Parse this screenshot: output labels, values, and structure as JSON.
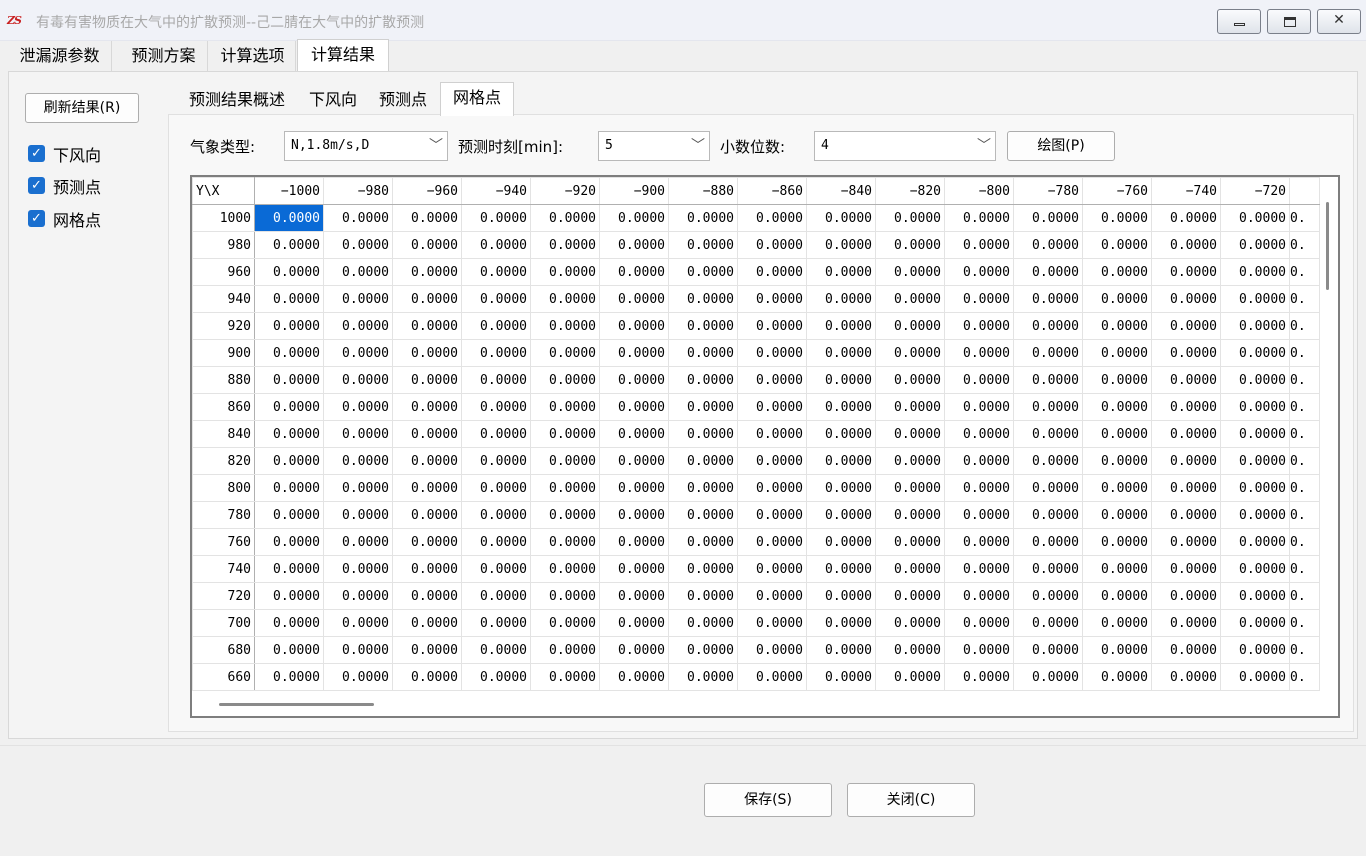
{
  "window": {
    "icon_text": "ZS",
    "title": "有毒有害物质在大气中的扩散预测--己二腈在大气中的扩散预测",
    "controls": {
      "minimize": "—",
      "maximize": "□",
      "close": "✕"
    }
  },
  "main_tabs": [
    "泄漏源参数",
    "预测方案",
    "计算选项",
    "计算结果"
  ],
  "sidebar": {
    "refresh_label": "刷新结果(R)",
    "checks": [
      {
        "label": "下风向",
        "checked": true
      },
      {
        "label": "预测点",
        "checked": true
      },
      {
        "label": "网格点",
        "checked": true
      }
    ]
  },
  "sub_tabs": [
    "预测结果概述",
    "下风向",
    "预测点",
    "网格点"
  ],
  "filters": {
    "weather_label": "气象类型:",
    "weather_value": "N,1.8m/s,D",
    "time_label": "预测时刻[min]:",
    "time_value": "5",
    "decimals_label": "小数位数:",
    "decimals_value": "4",
    "plot_label": "绘图(P)"
  },
  "grid": {
    "corner": "Y\\X",
    "columns": [
      "−1000",
      "−980",
      "−960",
      "−940",
      "−920",
      "−900",
      "−880",
      "−860",
      "−840",
      "−820",
      "−800",
      "−780",
      "−760",
      "−740",
      "−720",
      ""
    ],
    "rows": [
      {
        "y": "1000",
        "cells": [
          "0.0000",
          "0.0000",
          "0.0000",
          "0.0000",
          "0.0000",
          "0.0000",
          "0.0000",
          "0.0000",
          "0.0000",
          "0.0000",
          "0.0000",
          "0.0000",
          "0.0000",
          "0.0000",
          "0.0000",
          "0."
        ]
      },
      {
        "y": "980",
        "cells": [
          "0.0000",
          "0.0000",
          "0.0000",
          "0.0000",
          "0.0000",
          "0.0000",
          "0.0000",
          "0.0000",
          "0.0000",
          "0.0000",
          "0.0000",
          "0.0000",
          "0.0000",
          "0.0000",
          "0.0000",
          "0."
        ]
      },
      {
        "y": "960",
        "cells": [
          "0.0000",
          "0.0000",
          "0.0000",
          "0.0000",
          "0.0000",
          "0.0000",
          "0.0000",
          "0.0000",
          "0.0000",
          "0.0000",
          "0.0000",
          "0.0000",
          "0.0000",
          "0.0000",
          "0.0000",
          "0."
        ]
      },
      {
        "y": "940",
        "cells": [
          "0.0000",
          "0.0000",
          "0.0000",
          "0.0000",
          "0.0000",
          "0.0000",
          "0.0000",
          "0.0000",
          "0.0000",
          "0.0000",
          "0.0000",
          "0.0000",
          "0.0000",
          "0.0000",
          "0.0000",
          "0."
        ]
      },
      {
        "y": "920",
        "cells": [
          "0.0000",
          "0.0000",
          "0.0000",
          "0.0000",
          "0.0000",
          "0.0000",
          "0.0000",
          "0.0000",
          "0.0000",
          "0.0000",
          "0.0000",
          "0.0000",
          "0.0000",
          "0.0000",
          "0.0000",
          "0."
        ]
      },
      {
        "y": "900",
        "cells": [
          "0.0000",
          "0.0000",
          "0.0000",
          "0.0000",
          "0.0000",
          "0.0000",
          "0.0000",
          "0.0000",
          "0.0000",
          "0.0000",
          "0.0000",
          "0.0000",
          "0.0000",
          "0.0000",
          "0.0000",
          "0."
        ]
      },
      {
        "y": "880",
        "cells": [
          "0.0000",
          "0.0000",
          "0.0000",
          "0.0000",
          "0.0000",
          "0.0000",
          "0.0000",
          "0.0000",
          "0.0000",
          "0.0000",
          "0.0000",
          "0.0000",
          "0.0000",
          "0.0000",
          "0.0000",
          "0."
        ]
      },
      {
        "y": "860",
        "cells": [
          "0.0000",
          "0.0000",
          "0.0000",
          "0.0000",
          "0.0000",
          "0.0000",
          "0.0000",
          "0.0000",
          "0.0000",
          "0.0000",
          "0.0000",
          "0.0000",
          "0.0000",
          "0.0000",
          "0.0000",
          "0."
        ]
      },
      {
        "y": "840",
        "cells": [
          "0.0000",
          "0.0000",
          "0.0000",
          "0.0000",
          "0.0000",
          "0.0000",
          "0.0000",
          "0.0000",
          "0.0000",
          "0.0000",
          "0.0000",
          "0.0000",
          "0.0000",
          "0.0000",
          "0.0000",
          "0."
        ]
      },
      {
        "y": "820",
        "cells": [
          "0.0000",
          "0.0000",
          "0.0000",
          "0.0000",
          "0.0000",
          "0.0000",
          "0.0000",
          "0.0000",
          "0.0000",
          "0.0000",
          "0.0000",
          "0.0000",
          "0.0000",
          "0.0000",
          "0.0000",
          "0."
        ]
      },
      {
        "y": "800",
        "cells": [
          "0.0000",
          "0.0000",
          "0.0000",
          "0.0000",
          "0.0000",
          "0.0000",
          "0.0000",
          "0.0000",
          "0.0000",
          "0.0000",
          "0.0000",
          "0.0000",
          "0.0000",
          "0.0000",
          "0.0000",
          "0."
        ]
      },
      {
        "y": "780",
        "cells": [
          "0.0000",
          "0.0000",
          "0.0000",
          "0.0000",
          "0.0000",
          "0.0000",
          "0.0000",
          "0.0000",
          "0.0000",
          "0.0000",
          "0.0000",
          "0.0000",
          "0.0000",
          "0.0000",
          "0.0000",
          "0."
        ]
      },
      {
        "y": "760",
        "cells": [
          "0.0000",
          "0.0000",
          "0.0000",
          "0.0000",
          "0.0000",
          "0.0000",
          "0.0000",
          "0.0000",
          "0.0000",
          "0.0000",
          "0.0000",
          "0.0000",
          "0.0000",
          "0.0000",
          "0.0000",
          "0."
        ]
      },
      {
        "y": "740",
        "cells": [
          "0.0000",
          "0.0000",
          "0.0000",
          "0.0000",
          "0.0000",
          "0.0000",
          "0.0000",
          "0.0000",
          "0.0000",
          "0.0000",
          "0.0000",
          "0.0000",
          "0.0000",
          "0.0000",
          "0.0000",
          "0."
        ]
      },
      {
        "y": "720",
        "cells": [
          "0.0000",
          "0.0000",
          "0.0000",
          "0.0000",
          "0.0000",
          "0.0000",
          "0.0000",
          "0.0000",
          "0.0000",
          "0.0000",
          "0.0000",
          "0.0000",
          "0.0000",
          "0.0000",
          "0.0000",
          "0."
        ]
      },
      {
        "y": "700",
        "cells": [
          "0.0000",
          "0.0000",
          "0.0000",
          "0.0000",
          "0.0000",
          "0.0000",
          "0.0000",
          "0.0000",
          "0.0000",
          "0.0000",
          "0.0000",
          "0.0000",
          "0.0000",
          "0.0000",
          "0.0000",
          "0."
        ]
      },
      {
        "y": "680",
        "cells": [
          "0.0000",
          "0.0000",
          "0.0000",
          "0.0000",
          "0.0000",
          "0.0000",
          "0.0000",
          "0.0000",
          "0.0000",
          "0.0000",
          "0.0000",
          "0.0000",
          "0.0000",
          "0.0000",
          "0.0000",
          "0."
        ]
      },
      {
        "y": "660",
        "cells": [
          "0.0000",
          "0.0000",
          "0.0000",
          "0.0000",
          "0.0000",
          "0.0000",
          "0.0000",
          "0.0000",
          "0.0000",
          "0.0000",
          "0.0000",
          "0.0000",
          "0.0000",
          "0.0000",
          "0.0000",
          "0."
        ]
      }
    ]
  },
  "footer": {
    "save_label": "保存(S)",
    "close_label": "关闭(C)"
  }
}
